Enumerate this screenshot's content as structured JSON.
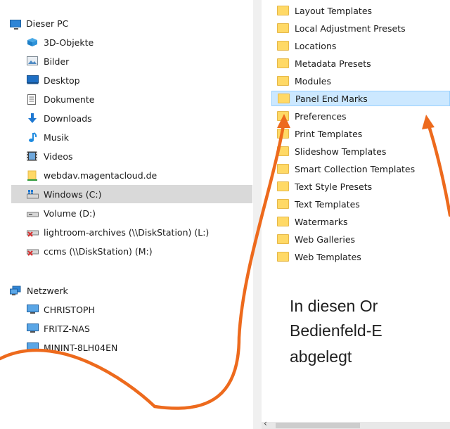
{
  "left_tree": {
    "this_pc": "Dieser PC",
    "items": [
      "3D-Objekte",
      "Bilder",
      "Desktop",
      "Dokumente",
      "Downloads",
      "Musik",
      "Videos",
      "webdav.magentacloud.de",
      "Windows (C:)",
      "Volume (D:)",
      "lightroom-archives (\\\\DiskStation) (L:)",
      "ccms (\\\\DiskStation) (M:)"
    ],
    "network": "Netzwerk",
    "network_items": [
      "CHRISTOPH",
      "FRITZ-NAS",
      "MININT-8LH04EN"
    ]
  },
  "folders": [
    "Layout Templates",
    "Local Adjustment Presets",
    "Locations",
    "Metadata Presets",
    "Modules",
    "Panel End Marks",
    "Preferences",
    "Print Templates",
    "Slideshow Templates",
    "Smart Collection Templates",
    "Text Style Presets",
    "Text Templates",
    "Watermarks",
    "Web Galleries",
    "Web Templates"
  ],
  "selected_folder": "Panel End Marks",
  "annotation": {
    "line1": "In diesen Or",
    "line2": "Bedienfeld-E",
    "line3": "abgelegt",
    "color": "#ED6A1D"
  },
  "scroll_left_glyph": "‹"
}
